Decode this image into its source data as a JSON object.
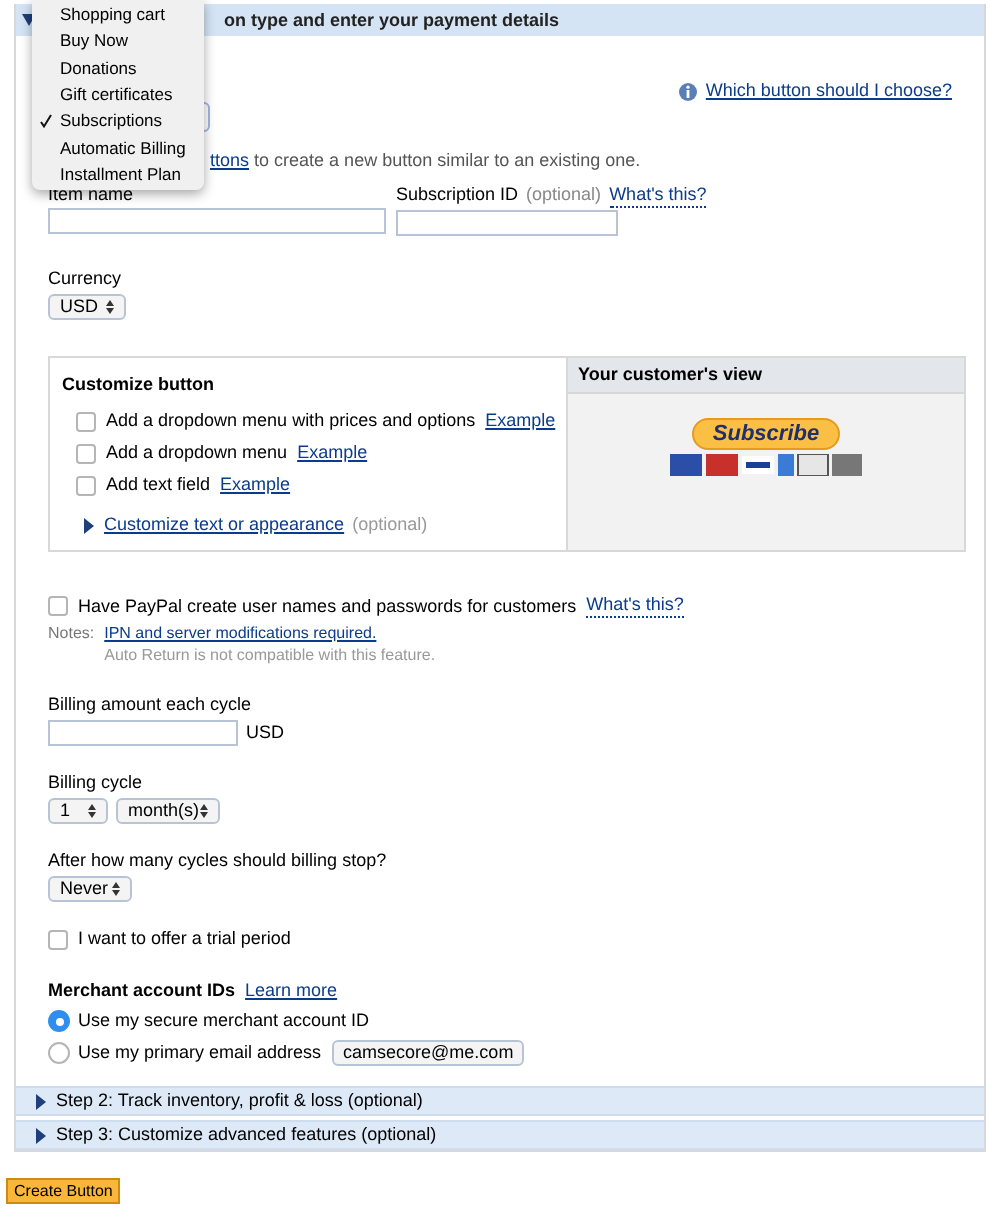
{
  "step1": {
    "title": "on type and enter your payment details",
    "expanded": true
  },
  "button_type_menu": {
    "items": [
      {
        "label": "Shopping cart",
        "selected": false
      },
      {
        "label": "Buy Now",
        "selected": false
      },
      {
        "label": "Donations",
        "selected": false
      },
      {
        "label": "Gift certificates",
        "selected": false
      },
      {
        "label": "Subscriptions",
        "selected": true
      },
      {
        "label": "Automatic Billing",
        "selected": false
      },
      {
        "label": "Installment Plan",
        "selected": false
      }
    ]
  },
  "help_link": "Which button should I choose?",
  "hint": {
    "link": "ttons",
    "text": "to create a new button similar to an existing one."
  },
  "item_name": {
    "label": "Item name"
  },
  "subscription_id": {
    "label": "Subscription ID",
    "optional": "(optional)",
    "help": "What's this?"
  },
  "currency": {
    "label": "Currency",
    "value": "USD"
  },
  "customize": {
    "title": "Customize button",
    "options": [
      {
        "label": "Add a dropdown menu with prices and options",
        "example": "Example",
        "checked": false
      },
      {
        "label": "Add a dropdown menu",
        "example": "Example",
        "checked": false
      },
      {
        "label": "Add text field",
        "example": "Example",
        "checked": false
      }
    ],
    "more": {
      "label": "Customize text or appearance",
      "optional": "(optional)",
      "expanded": false
    }
  },
  "preview": {
    "title": "Your customer's view",
    "button": "Subscribe"
  },
  "create_accounts": {
    "label": "Have PayPal create user names and passwords for customers",
    "help": "What's this?",
    "checked": false
  },
  "notes": {
    "label": "Notes:",
    "link": "IPN and server modifications required.",
    "text": "Auto Return is not compatible with this feature."
  },
  "billing_amount": {
    "label": "Billing amount each cycle",
    "currency": "USD"
  },
  "billing_cycle": {
    "label": "Billing cycle",
    "count": "1",
    "unit": "month(s)"
  },
  "stop": {
    "label": "After how many cycles should billing stop?",
    "value": "Never"
  },
  "trial": {
    "label": "I want to offer a trial period",
    "checked": false
  },
  "merchant": {
    "title": "Merchant account IDs",
    "link": "Learn more",
    "options": [
      {
        "label": "Use my secure merchant account ID",
        "selected": true
      },
      {
        "label": "Use my primary email address",
        "selected": false,
        "value": "camsecore@me.com"
      }
    ]
  },
  "steps": [
    {
      "label": "Step 2: Track inventory, profit & loss (optional)",
      "expanded": false
    },
    {
      "label": "Step 3: Customize advanced features (optional)",
      "expanded": false
    }
  ],
  "create_button": "Create Button"
}
